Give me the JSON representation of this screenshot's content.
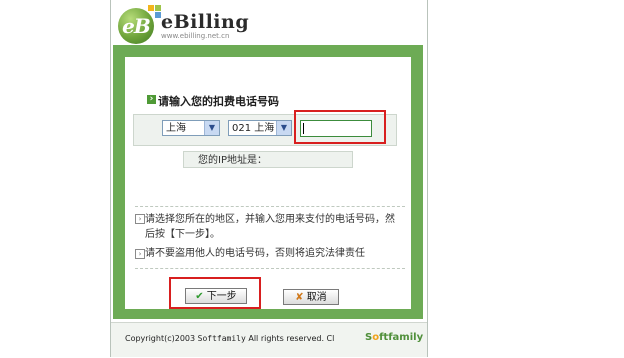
{
  "header": {
    "logo_mark": "eB",
    "title": "eBilling",
    "url": "www.ebilling.net.cn"
  },
  "form": {
    "prompt": "请输入您的扣费电话号码",
    "city_select": "上海",
    "area_select": "021 上海",
    "phone_value": "",
    "ip_label": "您的IP地址是："
  },
  "notes": [
    "请选择您所在的地区，并输入您用来支付的电话号码，然后按【下一步】。",
    "请不要盗用他人的电话号码，否则将追究法律责任"
  ],
  "buttons": {
    "next": "下一步",
    "cancel": "取消"
  },
  "footer": {
    "copyright_prefix": "Copyright(c)2003 ",
    "copyright_company": "Softfamily",
    "copyright_suffix": " All rights reserved. Cl",
    "brand_s": "S",
    "brand_o": "o",
    "brand_rest": "ftfamily"
  },
  "colors": {
    "frame_green": "#6dab55",
    "highlight_red": "#d81f1f"
  },
  "icons": {
    "prompt": "green-square-arrow-icon",
    "note": "bullet-arrow-icon",
    "next": "checkmark-icon",
    "cancel": "x-icon",
    "select_arrow": "chevron-down-icon"
  }
}
